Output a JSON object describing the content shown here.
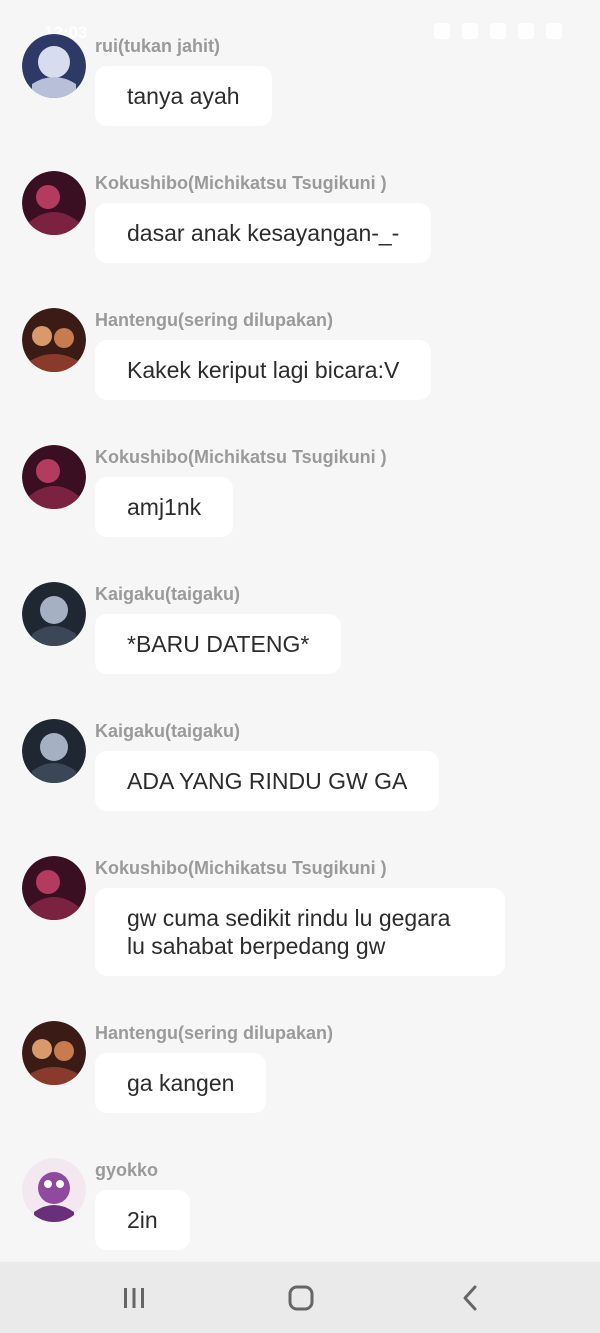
{
  "status_bar": {
    "time": "12:03"
  },
  "messages": [
    {
      "sender": "rui(tukan jahit)",
      "text": "tanya ayah",
      "avatar_color": "#3a4a7a"
    },
    {
      "sender": "Kokushibo(Michikatsu Tsugikuni )",
      "text": "dasar anak kesayangan-_-",
      "avatar_color": "#6a1f3c"
    },
    {
      "sender": "Hantengu(sering dilupakan)",
      "text": "Kakek keriput lagi bicara:V",
      "avatar_color": "#5a2a24"
    },
    {
      "sender": "Kokushibo(Michikatsu Tsugikuni )",
      "text": "amj1nk",
      "avatar_color": "#6a1f3c"
    },
    {
      "sender": "Kaigaku(taigaku)",
      "text": "*BARU DATENG*",
      "avatar_color": "#2a3444"
    },
    {
      "sender": "Kaigaku(taigaku)",
      "text": "ADA YANG RINDU GW GA",
      "avatar_color": "#2a3444"
    },
    {
      "sender": "Kokushibo(Michikatsu Tsugikuni )",
      "text": "gw cuma sedikit rindu lu gegara lu sahabat berpedang gw",
      "avatar_color": "#6a1f3c"
    },
    {
      "sender": "Hantengu(sering dilupakan)",
      "text": "ga kangen",
      "avatar_color": "#5a2a24"
    },
    {
      "sender": "gyokko",
      "text": "2in",
      "avatar_color": "#7a3f8a"
    }
  ],
  "nav": {
    "recents_icon": "recents-icon",
    "home_icon": "home-icon",
    "back_icon": "back-icon"
  }
}
